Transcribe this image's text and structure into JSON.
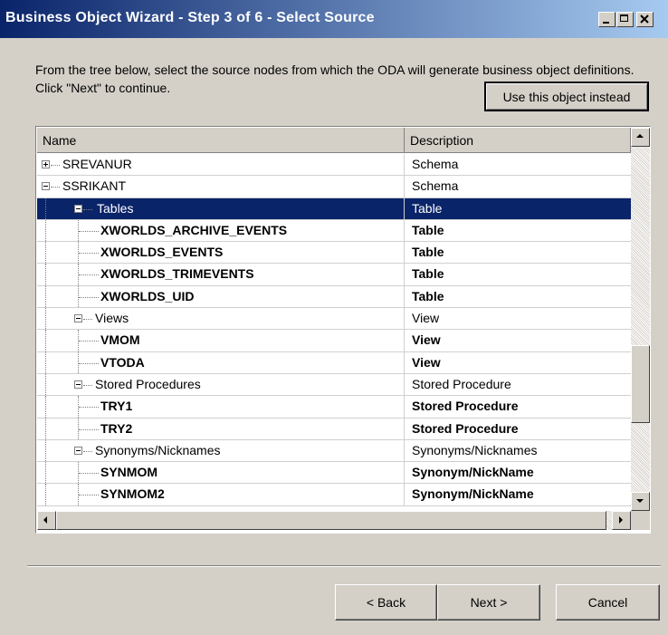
{
  "window": {
    "title": "Business Object Wizard - Step 3 of 6 - Select Source"
  },
  "intro_text": "From the tree below, select the source nodes from which the ODA will generate business object definitions. Click \"Next\" to continue.",
  "use_button": "Use this object instead",
  "tree": {
    "columns": {
      "name": "Name",
      "description": "Description"
    },
    "rows": [
      {
        "name": "SREVANUR",
        "desc": "Schema",
        "level": 0,
        "expander": "plus",
        "bold": false
      },
      {
        "name": "SSRIKANT",
        "desc": "Schema",
        "level": 0,
        "expander": "minus",
        "bold": false
      },
      {
        "name": "Tables",
        "desc": "Table",
        "level": 1,
        "expander": "minus",
        "bold": false,
        "selected": true
      },
      {
        "name": "XWORLDS_ARCHIVE_EVENTS",
        "desc": "Table",
        "level": 2,
        "bold": true
      },
      {
        "name": "XWORLDS_EVENTS",
        "desc": "Table",
        "level": 2,
        "bold": true
      },
      {
        "name": "XWORLDS_TRIMEVENTS",
        "desc": "Table",
        "level": 2,
        "bold": true
      },
      {
        "name": "XWORLDS_UID",
        "desc": "Table",
        "level": 2,
        "bold": true
      },
      {
        "name": "Views",
        "desc": "View",
        "level": 1,
        "expander": "minus",
        "bold": false
      },
      {
        "name": "VMOM",
        "desc": "View",
        "level": 2,
        "bold": true
      },
      {
        "name": "VTODA",
        "desc": "View",
        "level": 2,
        "bold": true
      },
      {
        "name": "Stored Procedures",
        "desc": "Stored Procedure",
        "level": 1,
        "expander": "minus",
        "bold": false
      },
      {
        "name": "TRY1",
        "desc": "Stored Procedure",
        "level": 2,
        "bold": true
      },
      {
        "name": "TRY2",
        "desc": "Stored Procedure",
        "level": 2,
        "bold": true
      },
      {
        "name": "Synonyms/Nicknames",
        "desc": "Synonyms/Nicknames",
        "level": 1,
        "expander": "minus",
        "bold": false
      },
      {
        "name": "SYNMOM",
        "desc": "Synonym/NickName",
        "level": 2,
        "bold": true
      },
      {
        "name": "SYNMOM2",
        "desc": "Synonym/NickName",
        "level": 2,
        "bold": true
      }
    ]
  },
  "buttons": {
    "back": "< Back",
    "next": "Next >",
    "cancel": "Cancel"
  },
  "colors": {
    "title_start": "#0a246a",
    "title_end": "#a6caf0",
    "selection": "#0a246a",
    "face": "#d4d0c8"
  }
}
